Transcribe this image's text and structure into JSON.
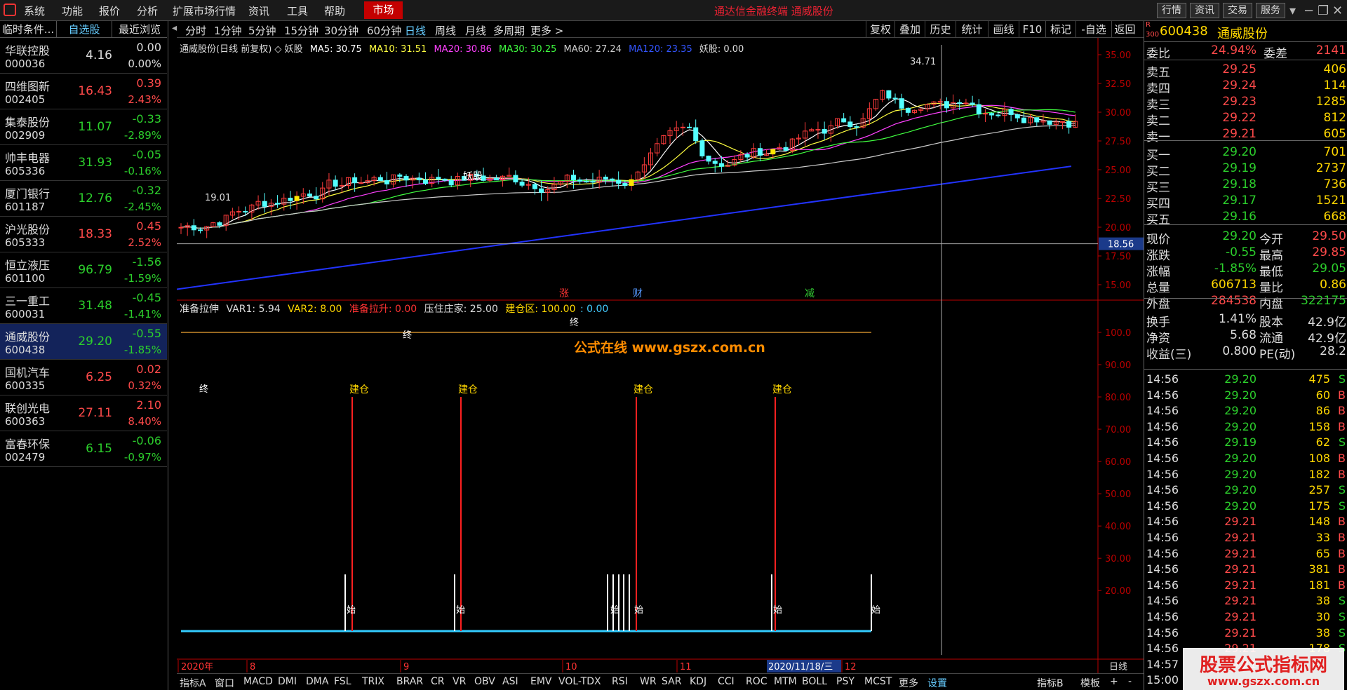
{
  "menubar": {
    "items": [
      "系统",
      "功能",
      "报价",
      "分析",
      "扩展市场行情",
      "资讯",
      "工具",
      "帮助"
    ],
    "market_tab": "市场",
    "title": "通达信金融终端 通威股份",
    "right_buttons": [
      "行情",
      "资讯",
      "交易",
      "服务"
    ]
  },
  "watchlist": {
    "tabs": [
      "临时条件...",
      "自选股",
      "最近浏览"
    ],
    "stocks": [
      {
        "name": "华联控股",
        "code": "000036",
        "price": "4.16",
        "change": "0.00",
        "pct": "0.00%",
        "dir": "flat"
      },
      {
        "name": "四维图新",
        "code": "002405",
        "price": "16.43",
        "change": "0.39",
        "pct": "2.43%",
        "dir": "up"
      },
      {
        "name": "集泰股份",
        "code": "002909",
        "price": "11.07",
        "change": "-0.33",
        "pct": "-2.89%",
        "dir": "down"
      },
      {
        "name": "帅丰电器",
        "code": "605336",
        "price": "31.93",
        "change": "-0.05",
        "pct": "-0.16%",
        "dir": "down"
      },
      {
        "name": "厦门银行",
        "code": "601187",
        "price": "12.76",
        "change": "-0.32",
        "pct": "-2.45%",
        "dir": "down"
      },
      {
        "name": "沪光股份",
        "code": "605333",
        "price": "18.33",
        "change": "0.45",
        "pct": "2.52%",
        "dir": "up"
      },
      {
        "name": "恒立液压",
        "code": "601100",
        "price": "96.79",
        "change": "-1.56",
        "pct": "-1.59%",
        "dir": "down"
      },
      {
        "name": "三一重工",
        "code": "600031",
        "price": "31.48",
        "change": "-0.45",
        "pct": "-1.41%",
        "dir": "down"
      },
      {
        "name": "通威股份",
        "code": "600438",
        "price": "29.20",
        "change": "-0.55",
        "pct": "-1.85%",
        "dir": "down"
      },
      {
        "name": "国机汽车",
        "code": "600335",
        "price": "6.25",
        "change": "0.02",
        "pct": "0.32%",
        "dir": "up"
      },
      {
        "name": "联创光电",
        "code": "600363",
        "price": "27.11",
        "change": "2.10",
        "pct": "8.40%",
        "dir": "up"
      },
      {
        "name": "富春环保",
        "code": "002479",
        "price": "6.15",
        "change": "-0.06",
        "pct": "-0.97%",
        "dir": "down"
      }
    ]
  },
  "timeframes": [
    "分时",
    "1分钟",
    "5分钟",
    "15分钟",
    "30分钟",
    "60分钟",
    "日线",
    "周线",
    "月线",
    "多周期",
    "更多 >"
  ],
  "active_timeframe": "日线",
  "chart_right_buttons": [
    "复权",
    "叠加",
    "历史",
    "统计",
    "画线",
    "F10",
    "标记",
    "-自选",
    "返回"
  ],
  "main_chart": {
    "header": "通威股份(日线 前复权) ◇ 妖股",
    "ma5": "MA5: 30.75",
    "ma10": "MA10: 31.51",
    "ma20": "MA20: 30.86",
    "ma30": "MA30: 30.25",
    "ma60": "MA60: 27.24",
    "ma120": "MA120: 23.35",
    "extra": "妖股: 0.00",
    "hi_label": "34.71",
    "lo_label": "19.01",
    "cross_price": "18.56",
    "yaoguo_label": "妖股",
    "markers": [
      "涨",
      "财",
      "减"
    ]
  },
  "sub_chart": {
    "name": "准备拉伸",
    "var1": "VAR1: 5.94",
    "var2": "VAR2: 8.00",
    "zhunbei": "准备拉升: 0.00",
    "yazhu": "压住庄家: 25.00",
    "jiancang": "建仓区: 100.00",
    "extra": ": 0.00",
    "jiancang_label": "建仓",
    "zhong_label": "终",
    "shi_label": "始",
    "watermark": "公式在线 www.gszx.com.cn"
  },
  "date_axis": {
    "labels": [
      "2020年",
      "8",
      "9",
      "10",
      "11",
      "2020/11/18/三",
      "12"
    ],
    "period": "日线"
  },
  "bottom_tabs": [
    "指标A",
    "窗口",
    "MACD",
    "DMI",
    "DMA",
    "FSL",
    "TRIX",
    "BRAR",
    "CR",
    "VR",
    "OBV",
    "ASI",
    "EMV",
    "VOL-TDX",
    "RSI",
    "WR",
    "SAR",
    "KDJ",
    "CCI",
    "ROC",
    "MTM",
    "BOLL",
    "PSY",
    "MCST",
    "更多",
    "设置"
  ],
  "bottom_right": [
    "指标B",
    "模板",
    "+",
    "-"
  ],
  "quote": {
    "code": "600438",
    "name": "通威股份",
    "r_label": "R",
    "num_label": "300",
    "weibi_label": "委比",
    "weibi": "24.94%",
    "weicha_label": "委差",
    "weicha": "2141",
    "asks": [
      {
        "l": "卖五",
        "p": "29.25",
        "v": "406"
      },
      {
        "l": "卖四",
        "p": "29.24",
        "v": "114"
      },
      {
        "l": "卖三",
        "p": "29.23",
        "v": "1285"
      },
      {
        "l": "卖二",
        "p": "29.22",
        "v": "812"
      },
      {
        "l": "卖一",
        "p": "29.21",
        "v": "605"
      }
    ],
    "bids": [
      {
        "l": "买一",
        "p": "29.20",
        "v": "701"
      },
      {
        "l": "买二",
        "p": "29.19",
        "v": "2737"
      },
      {
        "l": "买三",
        "p": "29.18",
        "v": "736"
      },
      {
        "l": "买四",
        "p": "29.17",
        "v": "1521"
      },
      {
        "l": "买五",
        "p": "29.16",
        "v": "668"
      }
    ],
    "stats": [
      {
        "a": "现价",
        "av": "29.20",
        "ac": "grn",
        "b": "今开",
        "bv": "29.50",
        "bc": "red"
      },
      {
        "a": "涨跌",
        "av": "-0.55",
        "ac": "grn",
        "b": "最高",
        "bv": "29.85",
        "bc": "red"
      },
      {
        "a": "涨幅",
        "av": "-1.85%",
        "ac": "grn",
        "b": "最低",
        "bv": "29.05",
        "bc": "grn"
      },
      {
        "a": "总量",
        "av": "606713",
        "ac": "yel",
        "b": "量比",
        "bv": "0.86",
        "bc": "yel"
      },
      {
        "a": "外盘",
        "av": "284538",
        "ac": "red",
        "b": "内盘",
        "bv": "322175",
        "bc": "grn"
      },
      {
        "a": "换手",
        "av": "1.41%",
        "ac": "wht",
        "b": "股本",
        "bv": "42.9亿",
        "bc": "wht"
      },
      {
        "a": "净资",
        "av": "5.68",
        "ac": "wht",
        "b": "流通",
        "bv": "42.9亿",
        "bc": "wht"
      },
      {
        "a": "收益(三)",
        "av": "0.800",
        "ac": "wht",
        "b": "PE(动)",
        "bv": "28.2",
        "bc": "wht"
      }
    ],
    "ticks": [
      {
        "t": "14:56",
        "p": "29.20",
        "v": "475",
        "s": "S"
      },
      {
        "t": "14:56",
        "p": "29.20",
        "v": "60",
        "s": "B"
      },
      {
        "t": "14:56",
        "p": "29.20",
        "v": "86",
        "s": "B"
      },
      {
        "t": "14:56",
        "p": "29.20",
        "v": "158",
        "s": "B"
      },
      {
        "t": "14:56",
        "p": "29.19",
        "v": "62",
        "s": "S"
      },
      {
        "t": "14:56",
        "p": "29.20",
        "v": "108",
        "s": "B"
      },
      {
        "t": "14:56",
        "p": "29.20",
        "v": "182",
        "s": "B"
      },
      {
        "t": "14:56",
        "p": "29.20",
        "v": "257",
        "s": "S"
      },
      {
        "t": "14:56",
        "p": "29.20",
        "v": "175",
        "s": "S"
      },
      {
        "t": "14:56",
        "p": "29.21",
        "v": "148",
        "s": "B"
      },
      {
        "t": "14:56",
        "p": "29.21",
        "v": "33",
        "s": "B"
      },
      {
        "t": "14:56",
        "p": "29.21",
        "v": "65",
        "s": "B"
      },
      {
        "t": "14:56",
        "p": "29.21",
        "v": "381",
        "s": "B"
      },
      {
        "t": "14:56",
        "p": "29.21",
        "v": "181",
        "s": "B"
      },
      {
        "t": "14:56",
        "p": "29.21",
        "v": "38",
        "s": "S"
      },
      {
        "t": "14:56",
        "p": "29.21",
        "v": "30",
        "s": "S"
      },
      {
        "t": "14:56",
        "p": "29.21",
        "v": "38",
        "s": "S"
      },
      {
        "t": "14:56",
        "p": "29.21",
        "v": "178",
        "s": "S"
      },
      {
        "t": "14:57",
        "p": "29.21",
        "v": "",
        "s": ""
      },
      {
        "t": "15:00",
        "p": "",
        "v": "",
        "s": ""
      }
    ]
  },
  "watermark_br": {
    "line1": "股票公式指标网",
    "line2": "www.gszx.com.cn"
  },
  "chart_data": {
    "type": "candlestick",
    "y_ticks_main": [
      "35.00",
      "32.50",
      "30.00",
      "27.50",
      "25.00",
      "22.50",
      "20.00",
      "17.50",
      "15.00"
    ],
    "y_ticks_sub": [
      "100.0",
      "90.00",
      "80.00",
      "70.00",
      "60.00",
      "50.00",
      "40.00",
      "30.00",
      "20.00"
    ],
    "close_last": 29.2,
    "high": 34.71,
    "low": 19.01
  }
}
